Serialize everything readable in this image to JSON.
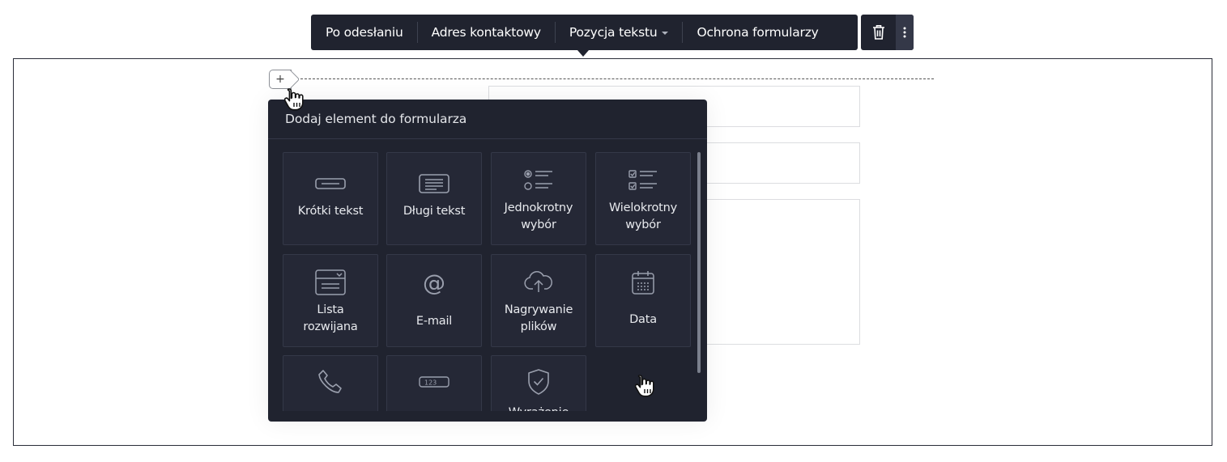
{
  "toolbar": {
    "items": [
      {
        "label": "Po odesłaniu"
      },
      {
        "label": "Adres kontaktowy"
      },
      {
        "label": "Pozycja tekstu"
      },
      {
        "label": "Ochrona formularzy"
      }
    ],
    "delete_icon": "trash-icon",
    "more_icon": "more-vertical-icon"
  },
  "add_button": {
    "label": "+"
  },
  "panel": {
    "title": "Dodaj element do formularza",
    "tiles": [
      {
        "label": "Krótki tekst",
        "icon": "short-text-icon"
      },
      {
        "label": "Długi tekst",
        "icon": "long-text-icon"
      },
      {
        "label": "Jednokrotny\nwybór",
        "icon": "single-choice-icon"
      },
      {
        "label": "Wielokrotny\nwybór",
        "icon": "multiple-choice-icon"
      },
      {
        "label": "Lista\nrozwijana",
        "icon": "dropdown-list-icon"
      },
      {
        "label": "E-mail",
        "icon": "at-sign-icon"
      },
      {
        "label": "Nagrywanie\nplików",
        "icon": "cloud-upload-icon"
      },
      {
        "label": "Data",
        "icon": "calendar-icon"
      },
      {
        "label": "",
        "icon": "phone-icon"
      },
      {
        "label": "",
        "icon": "number-field-icon"
      },
      {
        "label": "Wyrażenie",
        "icon": "shield-check-icon"
      }
    ]
  },
  "colors": {
    "toolbar_bg": "#20232f",
    "panel_bg": "#20232f",
    "tile_bg": "#252836",
    "tile_border": "#343848",
    "icon": "#9a9fad"
  }
}
